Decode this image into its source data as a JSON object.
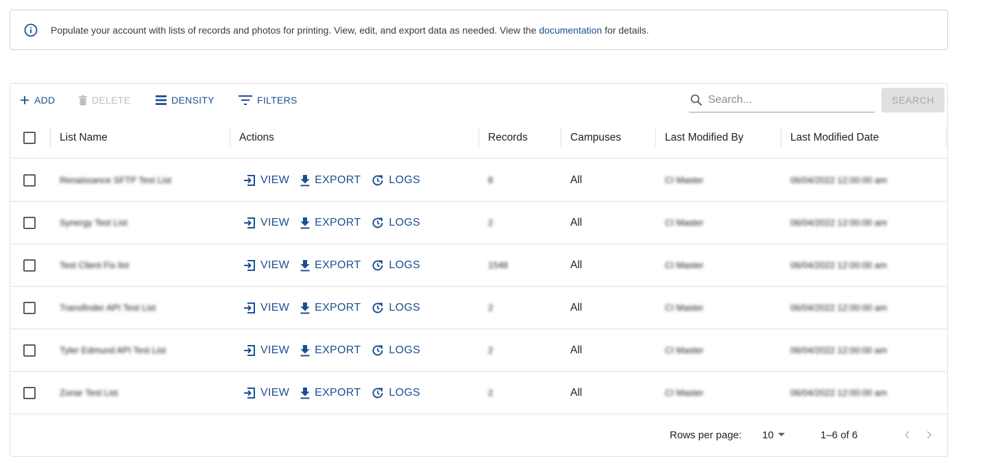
{
  "info": {
    "text_before": "Populate your account with lists of records and photos for printing. View, edit, and export data as needed. View the ",
    "link": "documentation",
    "text_after": " for details."
  },
  "toolbar": {
    "add": "ADD",
    "delete": "DELETE",
    "density": "DENSITY",
    "filters": "FILTERS",
    "search_placeholder": "Search...",
    "search_button": "SEARCH"
  },
  "columns": {
    "list_name": "List Name",
    "actions": "Actions",
    "records": "Records",
    "campuses": "Campuses",
    "last_modified_by": "Last Modified By",
    "last_modified_date": "Last Modified Date"
  },
  "actions": {
    "view": "VIEW",
    "export": "EXPORT",
    "logs": "LOGS"
  },
  "rows": [
    {
      "name": "Renaissance SFTP Test List",
      "records": "8",
      "campuses": "All",
      "modified_by": "CI Master",
      "modified_date": "06/04/2022 12:00:00 am"
    },
    {
      "name": "Synergy Test List",
      "records": "2",
      "campuses": "All",
      "modified_by": "CI Master",
      "modified_date": "06/04/2022 12:00:00 am"
    },
    {
      "name": "Test Client Fix list",
      "records": "1548",
      "campuses": "All",
      "modified_by": "CI Master",
      "modified_date": "06/04/2022 12:00:00 am"
    },
    {
      "name": "Transfinder API Test List",
      "records": "2",
      "campuses": "All",
      "modified_by": "CI Master",
      "modified_date": "06/04/2022 12:00:00 am"
    },
    {
      "name": "Tyler Edmund API Test List",
      "records": "2",
      "campuses": "All",
      "modified_by": "CI Master",
      "modified_date": "06/04/2022 12:00:00 am"
    },
    {
      "name": "Zonar Test List",
      "records": "2",
      "campuses": "All",
      "modified_by": "CI Master",
      "modified_date": "06/04/2022 12:00:00 am"
    }
  ],
  "pagination": {
    "rows_per_page_label": "Rows per page:",
    "rows_per_page": "10",
    "range": "1–6 of 6"
  },
  "colors": {
    "primary": "#1c4f90",
    "disabled": "#bdbdbd",
    "border": "#e0e0e0"
  }
}
